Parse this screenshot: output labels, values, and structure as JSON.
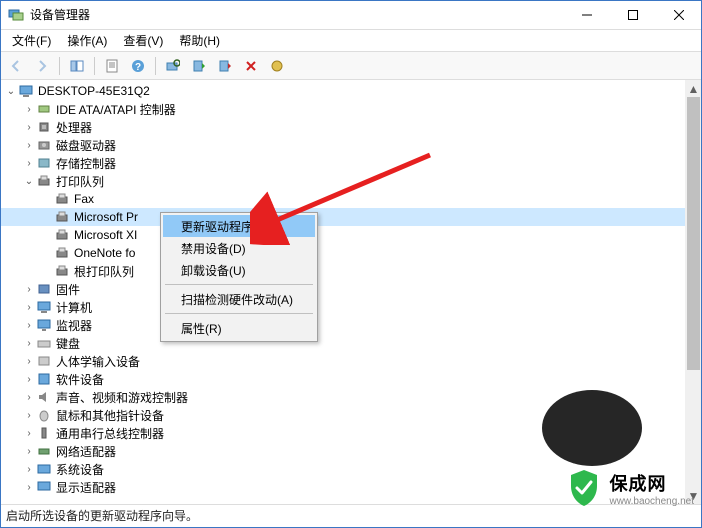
{
  "window": {
    "title": "设备管理器"
  },
  "menu": {
    "file": "文件(F)",
    "action": "操作(A)",
    "view": "查看(V)",
    "help": "帮助(H)"
  },
  "tree": {
    "root": "DESKTOP-45E31Q2",
    "ide": "IDE ATA/ATAPI 控制器",
    "cpu": "处理器",
    "disk": "磁盘驱动器",
    "storage": "存储控制器",
    "printq": "打印队列",
    "fax": "Fax",
    "msprint": "Microsoft Pr",
    "msxps": "Microsoft XI",
    "onenote": "OneNote fo",
    "rootprint": "根打印队列",
    "firmware": "固件",
    "computer": "计算机",
    "monitor": "监视器",
    "keyboard": "键盘",
    "hid": "人体学输入设备",
    "software": "软件设备",
    "sound": "声音、视频和游戏控制器",
    "mouse": "鼠标和其他指针设备",
    "usb": "通用串行总线控制器",
    "network": "网络适配器",
    "system": "系统设备",
    "display": "显示适配器"
  },
  "context": {
    "update": "更新驱动程序(P)",
    "disable": "禁用设备(D)",
    "uninstall": "卸载设备(U)",
    "scan": "扫描检测硬件改动(A)",
    "properties": "属性(R)"
  },
  "status": "启动所选设备的更新驱动程序向导。",
  "watermark": {
    "brand": "保成网",
    "url": "www.baocheng.net"
  }
}
